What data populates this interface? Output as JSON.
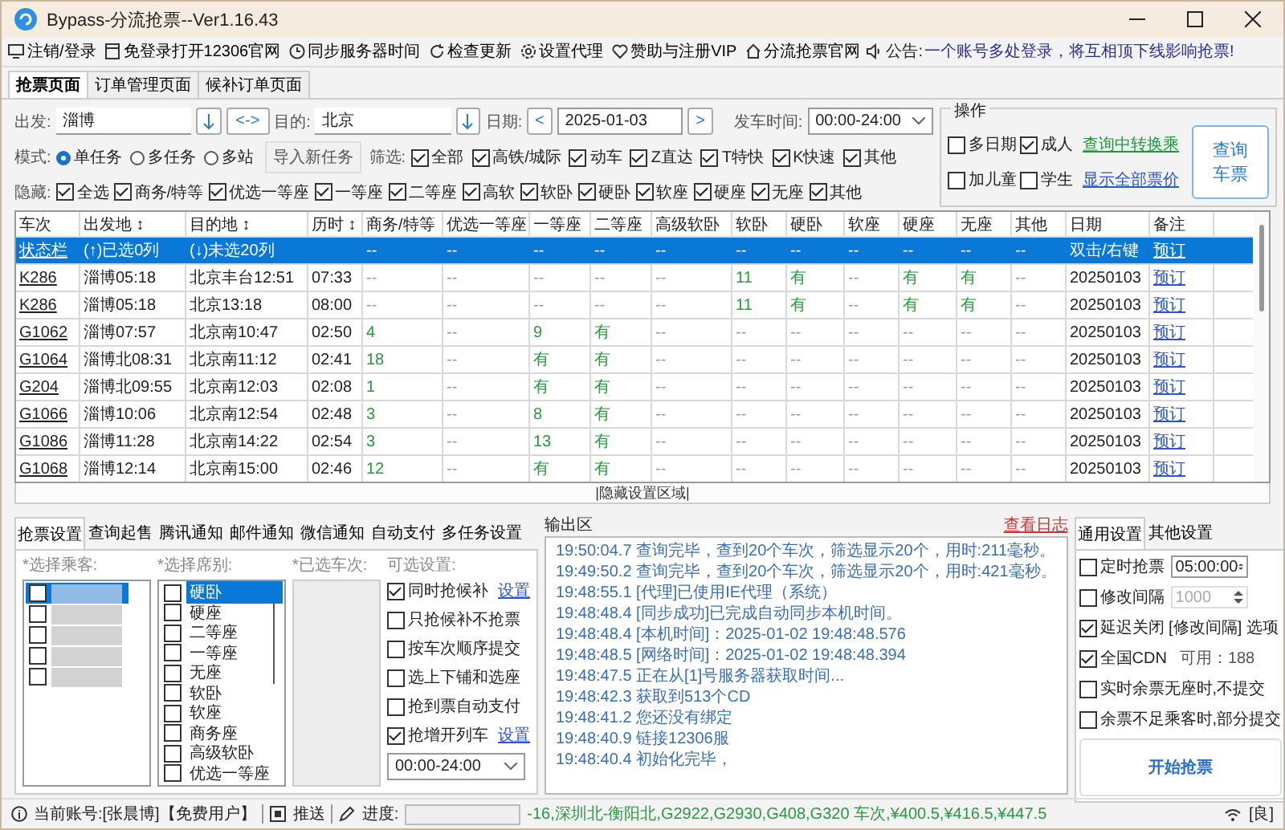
{
  "window": {
    "title": "Bypass-分流抢票--Ver1.16.43"
  },
  "menu": [
    {
      "label": "注销/登录",
      "kind": "monitor"
    },
    {
      "label": "免登录打开12306官网",
      "kind": "page"
    },
    {
      "label": "同步服务器时间",
      "kind": "clock"
    },
    {
      "label": "检查更新",
      "kind": "refresh"
    },
    {
      "label": "设置代理",
      "kind": "gear"
    },
    {
      "label": "赞助与注册VIP",
      "kind": "heart"
    },
    {
      "label": "分流抢票官网",
      "kind": "home"
    }
  ],
  "notice": {
    "label": "公告:",
    "text": "一个账号多处登录，将互相顶下线影响抢票!"
  },
  "tabs": [
    {
      "label": "抢票页面",
      "selected": true
    },
    {
      "label": "订单管理页面",
      "selected": false
    },
    {
      "label": "候补订单页面",
      "selected": false
    }
  ],
  "search": {
    "from_label": "出发:",
    "from": "淄博",
    "swap": "<->",
    "to_label": "目的:",
    "to": "北京",
    "date_label": "日期:",
    "prev": "<",
    "date": "2025-01-03",
    "next": ">",
    "time_label": "发车时间:",
    "time": "00:00-24:00"
  },
  "mode": {
    "label": "模式:",
    "options": [
      {
        "label": "单任务",
        "selected": true
      },
      {
        "label": "多任务",
        "selected": false
      },
      {
        "label": "多站",
        "selected": false
      }
    ],
    "import_button": "导入新任务"
  },
  "filter": {
    "label": "筛选:",
    "options": [
      {
        "label": "全部",
        "checked": true
      },
      {
        "label": "高铁/城际",
        "checked": true
      },
      {
        "label": "动车",
        "checked": true
      },
      {
        "label": "Z直达",
        "checked": true
      },
      {
        "label": "T特快",
        "checked": true
      },
      {
        "label": "K快速",
        "checked": true
      },
      {
        "label": "其他",
        "checked": true
      }
    ]
  },
  "hide": {
    "label": "隐藏:",
    "options": [
      {
        "label": "全选",
        "checked": true
      },
      {
        "label": "商务/特等",
        "checked": true
      },
      {
        "label": "优选一等座",
        "checked": true
      },
      {
        "label": "一等座",
        "checked": true
      },
      {
        "label": "二等座",
        "checked": true
      },
      {
        "label": "高软",
        "checked": true
      },
      {
        "label": "软卧",
        "checked": true
      },
      {
        "label": "硬卧",
        "checked": true
      },
      {
        "label": "软座",
        "checked": true
      },
      {
        "label": "硬座",
        "checked": true
      },
      {
        "label": "无座",
        "checked": true
      },
      {
        "label": "其他",
        "checked": true
      }
    ]
  },
  "operations": {
    "title": "操作",
    "options": [
      {
        "label": "多日期",
        "checked": false
      },
      {
        "label": "成人",
        "checked": true
      },
      {
        "label": "加儿童",
        "checked": false
      },
      {
        "label": "学生",
        "checked": false
      }
    ],
    "transfer_link": "查询中转换乘",
    "price_link": "显示全部票价",
    "query_button": [
      "查询",
      "车票"
    ]
  },
  "table": {
    "columns": [
      "车次",
      "出发地 ↕",
      "目的地 ↕",
      "历时 ↕",
      "商务/特等",
      "优选一等座",
      "一等座",
      "二等座",
      "高级软卧",
      "软卧",
      "硬卧",
      "软座",
      "硬座",
      "无座",
      "其他",
      "日期",
      "备注"
    ],
    "rows": [
      {
        "selected": true,
        "train": "状态栏",
        "from": "(↑)已选0列",
        "to": "(↓)未选20列",
        "duration": "",
        "seats": [
          {
            "text": "--",
            "available": false
          },
          {
            "text": "--",
            "available": false
          },
          {
            "text": "--",
            "available": false
          },
          {
            "text": "--",
            "available": false
          },
          {
            "text": "--",
            "available": false
          },
          {
            "text": "--",
            "available": false
          },
          {
            "text": "--",
            "available": false
          },
          {
            "text": "--",
            "available": false
          },
          {
            "text": "--",
            "available": false
          },
          {
            "text": "--",
            "available": false
          },
          {
            "text": "--",
            "available": false
          }
        ],
        "date": "双击/右键",
        "action": "预订"
      },
      {
        "selected": false,
        "train": "K286",
        "from": "淄博05:18",
        "to": "北京丰台12:51",
        "duration": "07:33",
        "seats": [
          {
            "text": "--",
            "available": false
          },
          {
            "text": "--",
            "available": false
          },
          {
            "text": "--",
            "available": false
          },
          {
            "text": "--",
            "available": false
          },
          {
            "text": "--",
            "available": false
          },
          {
            "text": "11",
            "available": true
          },
          {
            "text": "有",
            "available": true
          },
          {
            "text": "--",
            "available": false
          },
          {
            "text": "有",
            "available": true
          },
          {
            "text": "有",
            "available": true
          },
          {
            "text": "--",
            "available": false
          }
        ],
        "date": "20250103",
        "action": "预订"
      },
      {
        "selected": false,
        "train": "K286",
        "from": "淄博05:18",
        "to": "北京13:18",
        "duration": "08:00",
        "seats": [
          {
            "text": "--",
            "available": false
          },
          {
            "text": "--",
            "available": false
          },
          {
            "text": "--",
            "available": false
          },
          {
            "text": "--",
            "available": false
          },
          {
            "text": "--",
            "available": false
          },
          {
            "text": "11",
            "available": true
          },
          {
            "text": "有",
            "available": true
          },
          {
            "text": "--",
            "available": false
          },
          {
            "text": "有",
            "available": true
          },
          {
            "text": "有",
            "available": true
          },
          {
            "text": "--",
            "available": false
          }
        ],
        "date": "20250103",
        "action": "预订"
      },
      {
        "selected": false,
        "train": "G1062",
        "from": "淄博07:57",
        "to": "北京南10:47",
        "duration": "02:50",
        "seats": [
          {
            "text": "4",
            "available": true
          },
          {
            "text": "--",
            "available": false
          },
          {
            "text": "9",
            "available": true
          },
          {
            "text": "有",
            "available": true
          },
          {
            "text": "--",
            "available": false
          },
          {
            "text": "--",
            "available": false
          },
          {
            "text": "--",
            "available": false
          },
          {
            "text": "--",
            "available": false
          },
          {
            "text": "--",
            "available": false
          },
          {
            "text": "--",
            "available": false
          },
          {
            "text": "--",
            "available": false
          }
        ],
        "date": "20250103",
        "action": "预订"
      },
      {
        "selected": false,
        "train": "G1064",
        "from": "淄博北08:31",
        "to": "北京南11:12",
        "duration": "02:41",
        "seats": [
          {
            "text": "18",
            "available": true
          },
          {
            "text": "--",
            "available": false
          },
          {
            "text": "有",
            "available": true
          },
          {
            "text": "有",
            "available": true
          },
          {
            "text": "--",
            "available": false
          },
          {
            "text": "--",
            "available": false
          },
          {
            "text": "--",
            "available": false
          },
          {
            "text": "--",
            "available": false
          },
          {
            "text": "--",
            "available": false
          },
          {
            "text": "--",
            "available": false
          },
          {
            "text": "--",
            "available": false
          }
        ],
        "date": "20250103",
        "action": "预订"
      },
      {
        "selected": false,
        "train": "G204",
        "from": "淄博北09:55",
        "to": "北京南12:03",
        "duration": "02:08",
        "seats": [
          {
            "text": "1",
            "available": true
          },
          {
            "text": "--",
            "available": false
          },
          {
            "text": "有",
            "available": true
          },
          {
            "text": "有",
            "available": true
          },
          {
            "text": "--",
            "available": false
          },
          {
            "text": "--",
            "available": false
          },
          {
            "text": "--",
            "available": false
          },
          {
            "text": "--",
            "available": false
          },
          {
            "text": "--",
            "available": false
          },
          {
            "text": "--",
            "available": false
          },
          {
            "text": "--",
            "available": false
          }
        ],
        "date": "20250103",
        "action": "预订"
      },
      {
        "selected": false,
        "train": "G1066",
        "from": "淄博10:06",
        "to": "北京南12:54",
        "duration": "02:48",
        "seats": [
          {
            "text": "3",
            "available": true
          },
          {
            "text": "--",
            "available": false
          },
          {
            "text": "8",
            "available": true
          },
          {
            "text": "有",
            "available": true
          },
          {
            "text": "--",
            "available": false
          },
          {
            "text": "--",
            "available": false
          },
          {
            "text": "--",
            "available": false
          },
          {
            "text": "--",
            "available": false
          },
          {
            "text": "--",
            "available": false
          },
          {
            "text": "--",
            "available": false
          },
          {
            "text": "--",
            "available": false
          }
        ],
        "date": "20250103",
        "action": "预订"
      },
      {
        "selected": false,
        "train": "G1086",
        "from": "淄博11:28",
        "to": "北京南14:22",
        "duration": "02:54",
        "seats": [
          {
            "text": "3",
            "available": true
          },
          {
            "text": "--",
            "available": false
          },
          {
            "text": "13",
            "available": true
          },
          {
            "text": "有",
            "available": true
          },
          {
            "text": "--",
            "available": false
          },
          {
            "text": "--",
            "available": false
          },
          {
            "text": "--",
            "available": false
          },
          {
            "text": "--",
            "available": false
          },
          {
            "text": "--",
            "available": false
          },
          {
            "text": "--",
            "available": false
          },
          {
            "text": "--",
            "available": false
          }
        ],
        "date": "20250103",
        "action": "预订"
      },
      {
        "selected": false,
        "train": "G1068",
        "from": "淄博12:14",
        "to": "北京南15:00",
        "duration": "02:46",
        "seats": [
          {
            "text": "12",
            "available": true
          },
          {
            "text": "--",
            "available": false
          },
          {
            "text": "有",
            "available": true
          },
          {
            "text": "有",
            "available": true
          },
          {
            "text": "--",
            "available": false
          },
          {
            "text": "--",
            "available": false
          },
          {
            "text": "--",
            "available": false
          },
          {
            "text": "--",
            "available": false
          },
          {
            "text": "--",
            "available": false
          },
          {
            "text": "--",
            "available": false
          },
          {
            "text": "--",
            "available": false
          }
        ],
        "date": "20250103",
        "action": "预订"
      }
    ]
  },
  "hidden_settings": "|隐藏设置区域|",
  "settings_tabs": [
    {
      "label": "抢票设置",
      "selected": true
    },
    {
      "label": "查询起售",
      "selected": false
    },
    {
      "label": "腾讯通知",
      "selected": false
    },
    {
      "label": "邮件通知",
      "selected": false
    },
    {
      "label": "微信通知",
      "selected": false
    },
    {
      "label": "自动支付",
      "selected": false
    },
    {
      "label": "多任务设置",
      "selected": false
    }
  ],
  "passengers": {
    "label": "*选择乘客:",
    "items": [
      {
        "selected": true,
        "checked": false
      },
      {
        "selected": false,
        "checked": false
      },
      {
        "selected": false,
        "checked": false
      },
      {
        "selected": false,
        "checked": false
      },
      {
        "selected": false,
        "checked": false
      }
    ]
  },
  "seat_types": {
    "label": "*选择席别:",
    "items": [
      {
        "label": "硬卧",
        "checked": false,
        "selected": true
      },
      {
        "label": "硬座",
        "checked": false,
        "selected": false
      },
      {
        "label": "二等座",
        "checked": false,
        "selected": false
      },
      {
        "label": "一等座",
        "checked": false,
        "selected": false
      },
      {
        "label": "无座",
        "checked": false,
        "selected": false
      },
      {
        "label": "软卧",
        "checked": false,
        "selected": false
      },
      {
        "label": "软座",
        "checked": false,
        "selected": false
      },
      {
        "label": "商务座",
        "checked": false,
        "selected": false
      },
      {
        "label": "高级软卧",
        "checked": false,
        "selected": false
      },
      {
        "label": "优选一等座",
        "checked": false,
        "selected": false
      }
    ]
  },
  "selected_trains": {
    "label": "*已选车次:"
  },
  "options": {
    "label": "可选设置:",
    "items": [
      {
        "label": "同时抢候补",
        "checked": true,
        "link": "设置"
      },
      {
        "label": "只抢候补不抢票",
        "checked": false
      },
      {
        "label": "按车次顺序提交",
        "checked": false
      },
      {
        "label": "选上下铺和选座",
        "checked": false
      },
      {
        "label": "抢到票自动支付",
        "checked": false
      },
      {
        "label": "抢增开列车",
        "checked": true,
        "link": "设置"
      }
    ],
    "time": "00:00-24:00"
  },
  "output": {
    "title": "输出区",
    "log_link": "查看日志",
    "lines": [
      {
        "time": "19:50:04.7",
        "text": "查询完毕，查到20个车次，筛选显示20个，用时:211毫秒。"
      },
      {
        "time": "19:49:50.2",
        "text": "查询完毕，查到20个车次，筛选显示20个，用时:421毫秒。"
      },
      {
        "time": "19:48:55.1",
        "text": "[代理]已使用IE代理（系统）"
      },
      {
        "time": "19:48:48.4",
        "text": "[同步成功]已完成自动同步本机时间。"
      },
      {
        "time": "19:48:48.4",
        "text": "[本机时间]：2025-01-02 19:48:48.576"
      },
      {
        "time": "19:48:48.5",
        "text": "[网络时间]：2025-01-02 19:48:48.394"
      },
      {
        "time": "19:48:47.5",
        "text": "正在从[1]号服务器获取时间..."
      },
      {
        "time": "19:48:42.3",
        "text": "获取到513个CD"
      },
      {
        "time": "19:48:41.2",
        "text": "您还没有绑定"
      },
      {
        "time": "19:48:40.9",
        "text": "链接12306服"
      },
      {
        "time": "19:48:40.4",
        "text": "初始化完毕，"
      }
    ]
  },
  "general_tabs": [
    {
      "label": "通用设置",
      "selected": true
    },
    {
      "label": "其他设置",
      "selected": false
    }
  ],
  "general": [
    {
      "kind": "spin",
      "label": "定时抢票",
      "checked": false,
      "value": "05:00:00",
      "disabled": false
    },
    {
      "kind": "spin",
      "label": "修改间隔",
      "checked": false,
      "value": "1000",
      "disabled": true
    },
    {
      "kind": "check",
      "label": "延迟关闭 [修改间隔] 选项",
      "checked": true
    },
    {
      "kind": "cdn",
      "label": "全国CDN",
      "checked": true,
      "note": "可用：188"
    },
    {
      "kind": "check",
      "label": "实时余票无座时,不提交",
      "checked": false
    },
    {
      "kind": "check",
      "label": "余票不足乘客时,部分提交",
      "checked": false
    }
  ],
  "start_button": "开始抢票",
  "status_bar": {
    "account": "当前账号:[张晨博]【免费用户】",
    "push": "推送",
    "progress_label": "进度:",
    "progress_bar": {
      "level": 0
    },
    "message": "-16,深圳北-衡阳北,G2922,G2930,G408,G320 车次,¥400.5,¥416.5,¥447.5",
    "network": "[良]"
  }
}
